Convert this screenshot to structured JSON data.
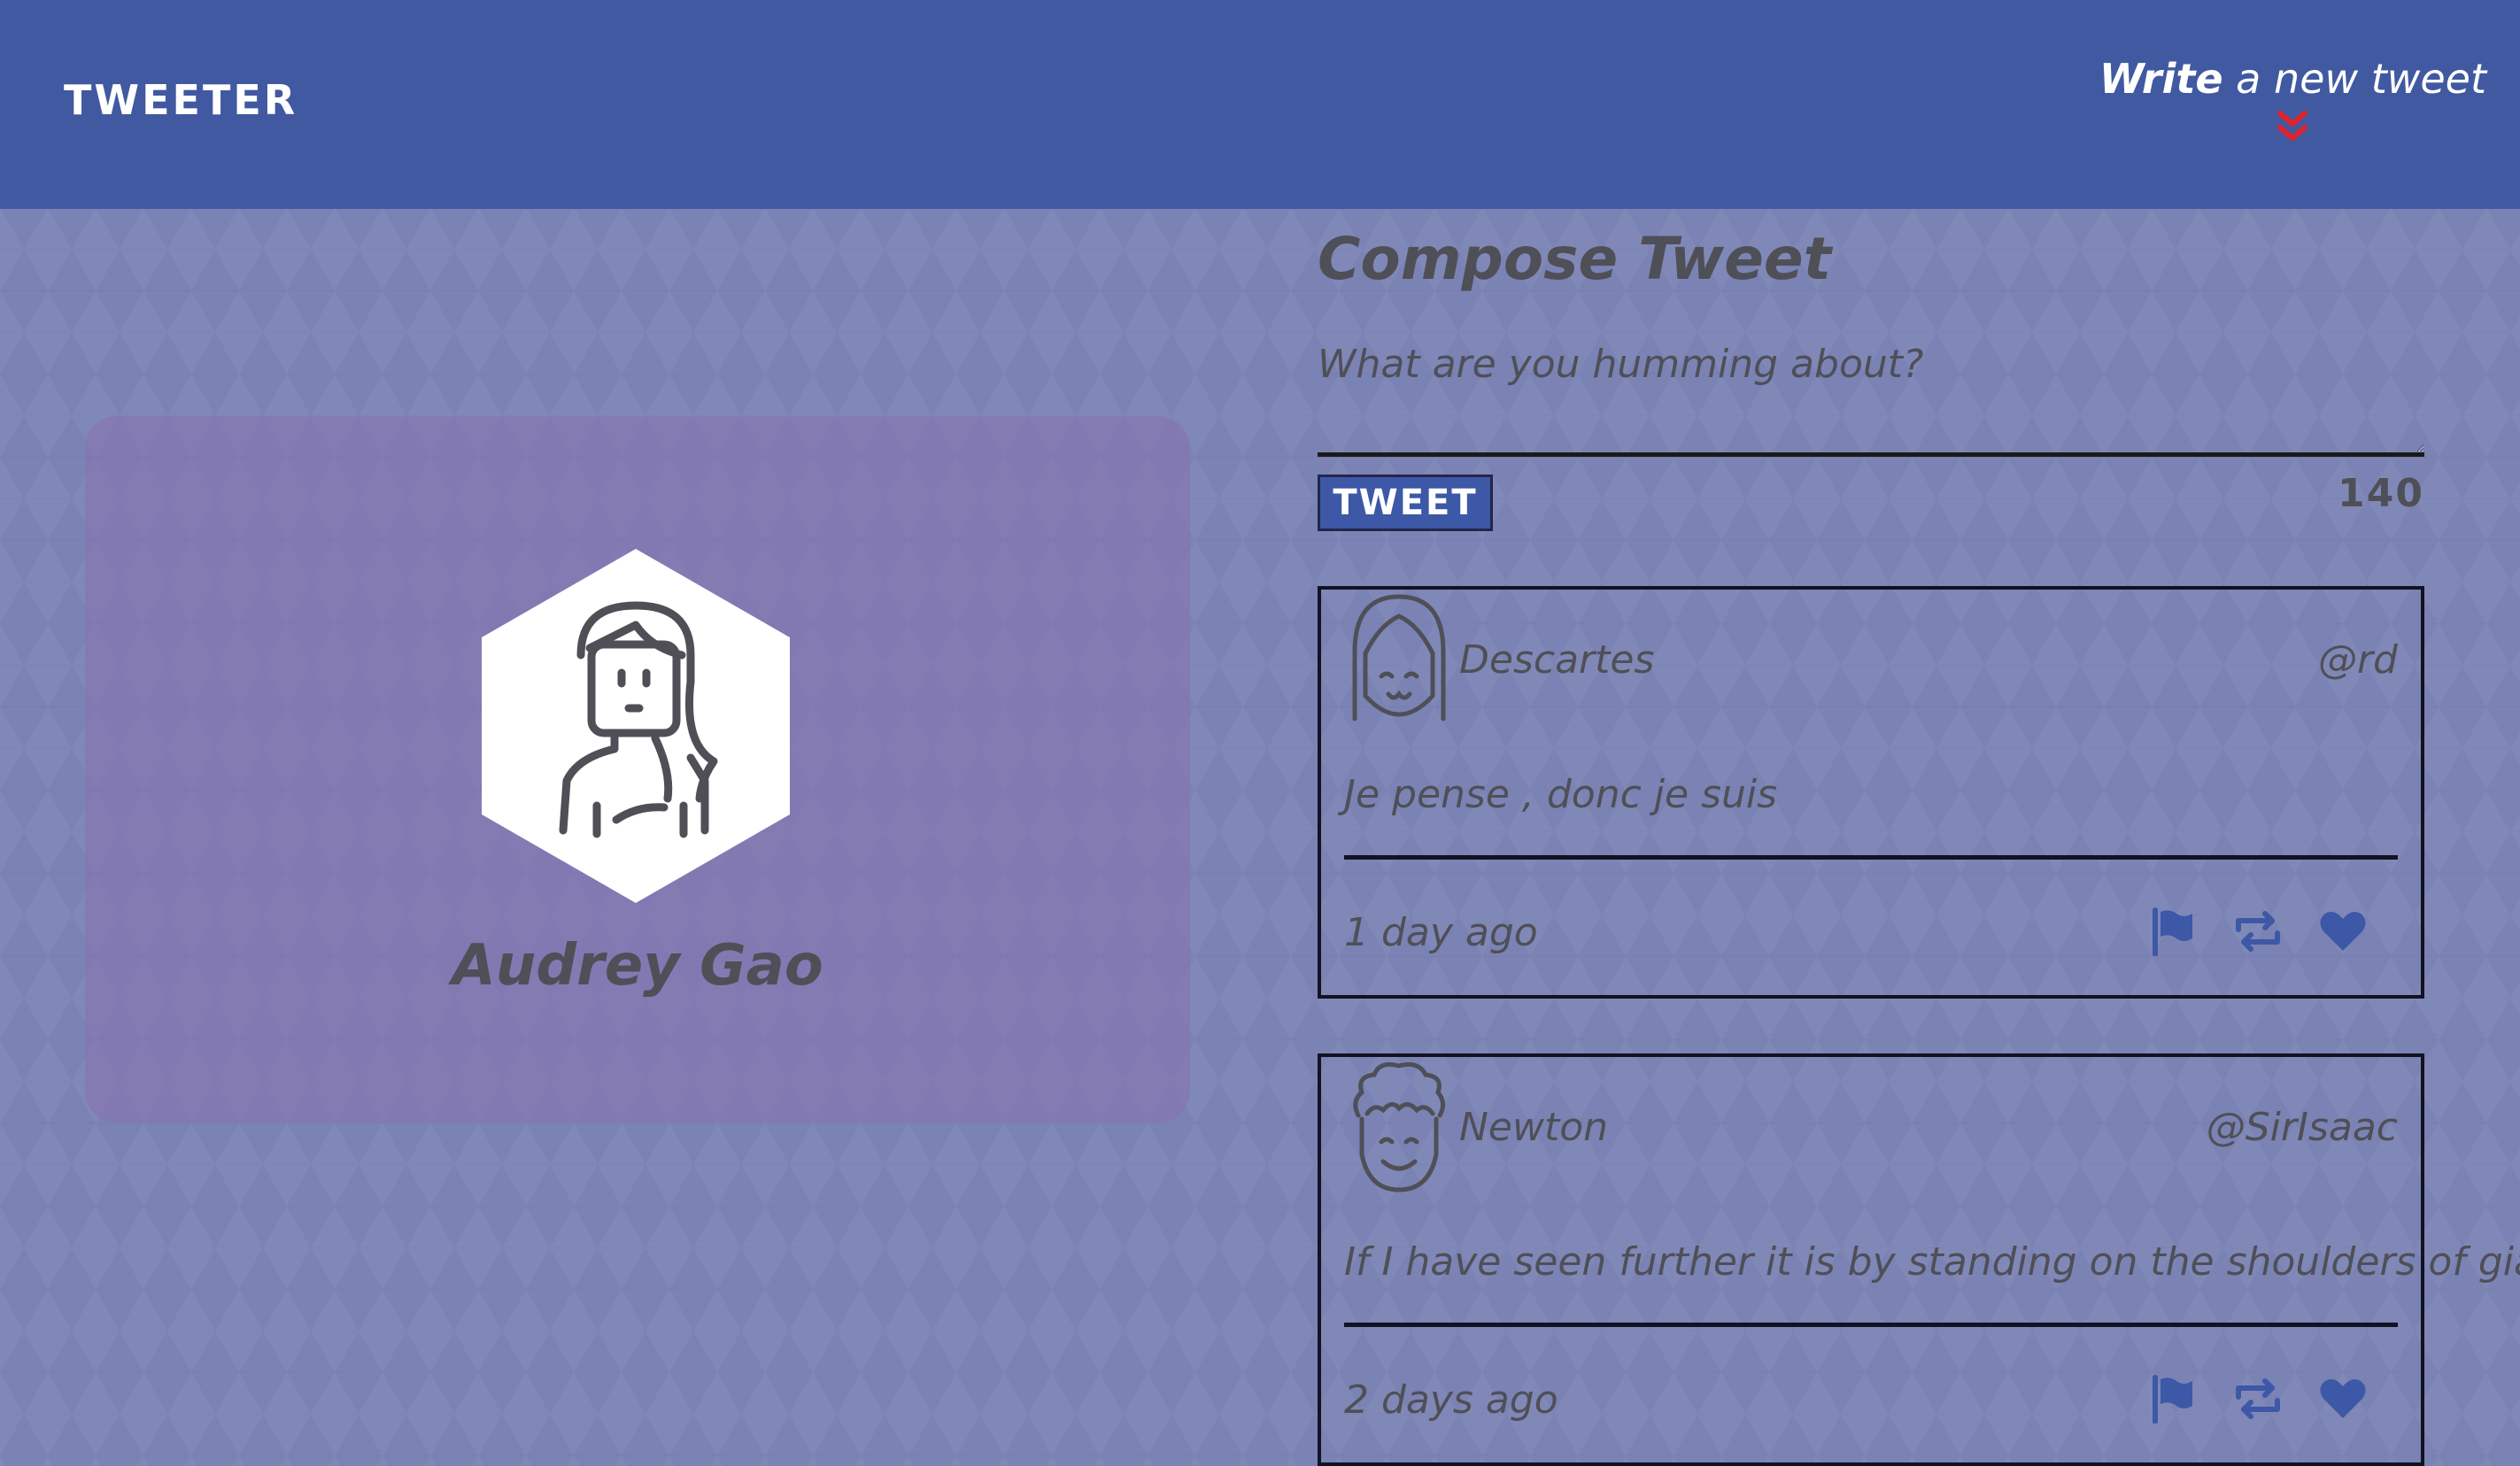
{
  "nav": {
    "brand": "TWEETER",
    "write_bold": "Write",
    "write_rest": " a new tweet",
    "toggle_icon": "chevron-double-down-icon",
    "toggle_color": "#e0222b"
  },
  "profile": {
    "name": "Audrey Gao",
    "avatar_icon": "woman-avatar-icon"
  },
  "compose": {
    "title": "Compose Tweet",
    "placeholder": "What are you humming about?",
    "button_label": "TWEET",
    "counter": "140"
  },
  "tweets": [
    {
      "name": "Descartes",
      "handle": "@rd",
      "content": "Je pense , donc je suis",
      "time": "1 day ago",
      "avatar_icon": "girl-avatar-icon"
    },
    {
      "name": "Newton",
      "handle": "@SirIsaac",
      "content": "If I have seen further it is by standing on the shoulders of giants",
      "time": "2 days ago",
      "avatar_icon": "curly-hair-avatar-icon"
    }
  ],
  "actions": [
    "flag-icon",
    "retweet-icon",
    "heart-icon"
  ],
  "colors": {
    "nav": "#4159a1",
    "background": "#7a83b4",
    "icon_blue": "#3d58a6",
    "text": "#4f4f57"
  }
}
